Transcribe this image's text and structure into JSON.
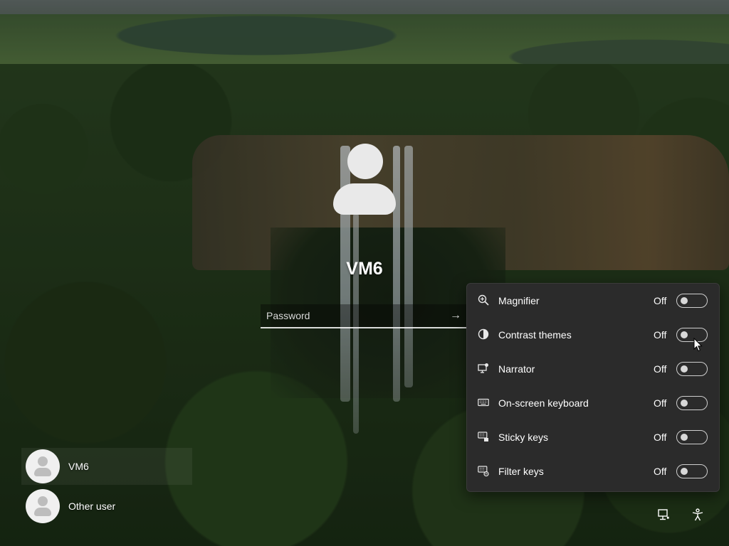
{
  "user": {
    "name": "VM6",
    "password_placeholder": "Password"
  },
  "user_list": [
    {
      "name": "VM6",
      "selected": true
    },
    {
      "name": "Other user",
      "selected": false
    }
  ],
  "accessibility": {
    "items": [
      {
        "label": "Magnifier",
        "state": "Off",
        "icon": "magnifier-icon"
      },
      {
        "label": "Contrast themes",
        "state": "Off",
        "icon": "contrast-icon"
      },
      {
        "label": "Narrator",
        "state": "Off",
        "icon": "narrator-icon"
      },
      {
        "label": "On-screen keyboard",
        "state": "Off",
        "icon": "keyboard-icon"
      },
      {
        "label": "Sticky keys",
        "state": "Off",
        "icon": "sticky-keys-icon"
      },
      {
        "label": "Filter keys",
        "state": "Off",
        "icon": "filter-keys-icon"
      }
    ]
  },
  "tray": {
    "network_icon": "network-icon",
    "accessibility_icon": "accessibility-icon"
  },
  "colors": {
    "panel_bg": "#2b2b2b",
    "toggle_border": "#cfcfcf",
    "text": "#ffffff"
  }
}
